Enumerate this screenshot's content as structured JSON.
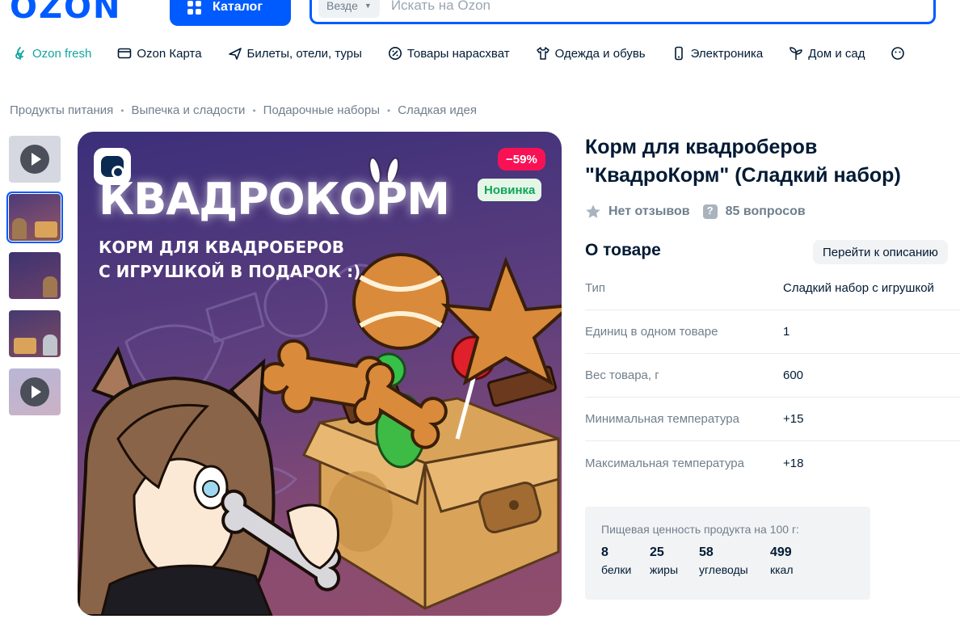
{
  "header": {
    "logo": "OZON",
    "catalog_label": "Каталог",
    "search_scope": "Везде",
    "search_placeholder": "Искать на Ozon"
  },
  "nav": [
    {
      "label": "Ozon fresh",
      "icon": "leaf-icon"
    },
    {
      "label": "Ozon Карта",
      "icon": "card-icon"
    },
    {
      "label": "Билеты, отели, туры",
      "icon": "plane-icon"
    },
    {
      "label": "Товары нарасхват",
      "icon": "discount-icon"
    },
    {
      "label": "Одежда и обувь",
      "icon": "clothes-icon"
    },
    {
      "label": "Электроника",
      "icon": "phone-icon"
    },
    {
      "label": "Дом и сад",
      "icon": "plant-icon"
    }
  ],
  "breadcrumbs": [
    "Продукты питания",
    "Выпечка и сладости",
    "Подарочные наборы",
    "Сладкая идея"
  ],
  "gallery": {
    "title": "КВАДРОКОРМ",
    "subtitle": "КОРМ ДЛЯ КВАДРОБЕРОВ\nС ИГРУШКОЙ В ПОДАРОК :)",
    "discount": "−59%",
    "badge": "Новинка"
  },
  "product": {
    "title": "Корм для квадроберов \"КвадроКорм\" (Сладкий набор)",
    "reviews": "Нет отзывов",
    "questions": "85 вопросов"
  },
  "about": {
    "title": "О товаре",
    "link": "Перейти к описанию",
    "specs": [
      {
        "key": "Тип",
        "value": "Сладкий набор с игрушкой"
      },
      {
        "key": "Единиц в одном товаре",
        "value": "1"
      },
      {
        "key": "Вес товара, г",
        "value": "600"
      },
      {
        "key": "Минимальная температура",
        "value": "+15"
      },
      {
        "key": "Максимальная температура",
        "value": "+18"
      }
    ]
  },
  "nutrition": {
    "title": "Пищевая ценность продукта на 100 г:",
    "items": [
      {
        "value": "8",
        "label": "белки"
      },
      {
        "value": "25",
        "label": "жиры"
      },
      {
        "value": "58",
        "label": "углеводы"
      },
      {
        "value": "499",
        "label": "ккал"
      }
    ]
  },
  "colors": {
    "brand": "#005bff",
    "discount": "#f91155",
    "new_badge": "#10a35a",
    "fresh": "#10a5a0"
  }
}
